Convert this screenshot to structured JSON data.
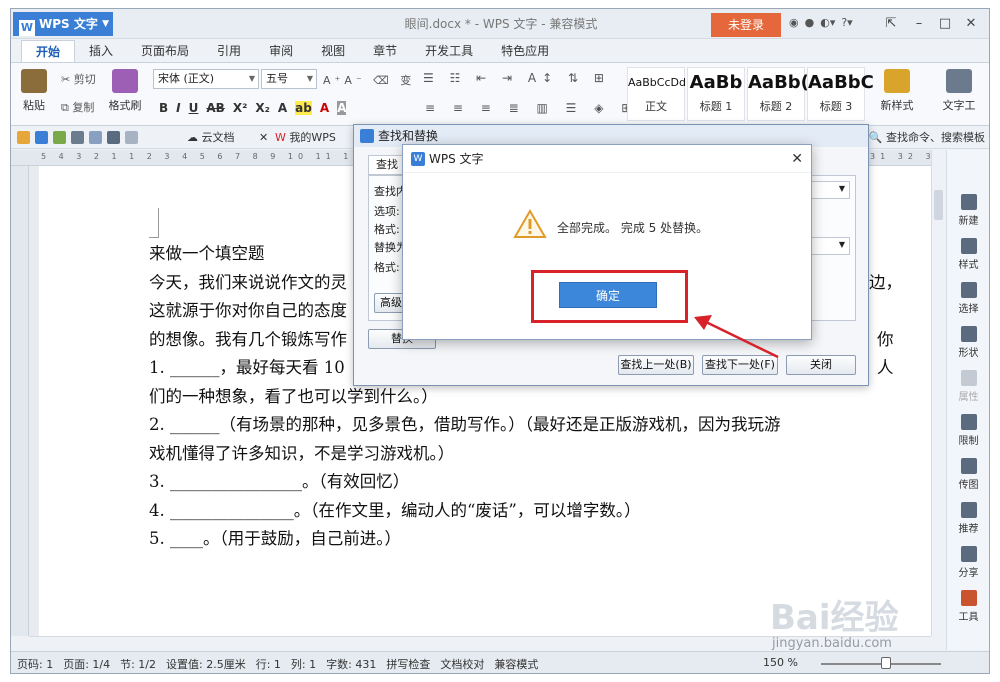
{
  "window": {
    "app_menu": "WPS 文字",
    "title": "眼间.docx * - WPS 文字 - 兼容模式",
    "login": "未登录"
  },
  "tabs": [
    "开始",
    "插入",
    "页面布局",
    "引用",
    "审阅",
    "视图",
    "章节",
    "开发工具",
    "特色应用"
  ],
  "ribbon": {
    "paste": "粘贴",
    "cut": "剪切",
    "copy": "复制",
    "format_painter": "格式刷",
    "font_name": "宋体 (正文)",
    "font_size": "五号",
    "styles": [
      {
        "sample": "AaBbCcDd",
        "label": "正文"
      },
      {
        "sample": "AaBb",
        "label": "标题 1"
      },
      {
        "sample": "AaBb(",
        "label": "标题 2"
      },
      {
        "sample": "AaBbC",
        "label": "标题 3"
      }
    ],
    "new_style": "新样式",
    "text_tool": "文字工"
  },
  "quickbar": {
    "cloud_doc": "云文档",
    "my_wps": "我的WPS",
    "search": "查找命令、搜索模板"
  },
  "ruler": "5 4 3 2 1 1 2 3 4 5 6 7 8 9 10 11 12 13 14 15 16 17 18 19 20 21 22 23 24 25 26 27 28 29 30 31 32 33 34 35 36 37 38 39 40 41",
  "document": {
    "lines": [
      "来做一个填空题",
      "今天，我们来说说作文的灵",
      "这就源于你对你自己的态度",
      "的想像。我有几个锻炼写作",
      "1. ______，最好每天看 10",
      "们的一种想象，看了也可以学到什么。）",
      "2. ______（有场景的那种，见多景色，借助写作。）（最好还是正版游戏机，因为我玩游",
      "戏机懂得了许多知识，不是学习游戏机。）",
      "3. ________________。（有效回忆）",
      "4. _______________。（在作文里，编动人的“废话”，可以增字数。）",
      "5. ____。（用于鼓励，自己前进。）"
    ],
    "right_fragments": [
      "边，",
      "你",
      "人"
    ]
  },
  "side_panel": [
    "新建",
    "样式",
    "选择",
    "形状",
    "属性",
    "限制",
    "传图",
    "推荐",
    "分享",
    "工具"
  ],
  "status": {
    "items": [
      "页码: 1",
      "页面: 1/4",
      "节: 1/2",
      "设置值: 2.5厘米",
      "行: 1",
      "列: 1",
      "字数: 431",
      "拼写检查",
      "文档校对",
      "兼容模式"
    ],
    "zoom": "150 %"
  },
  "find_replace": {
    "title": "查找和替换",
    "tab_find": "查找",
    "find_label": "查找内",
    "options_label": "选项:",
    "format_label1": "格式:",
    "replace_label": "替换为",
    "format_label2": "格式:",
    "advanced": "高级",
    "replace_btn": "替换",
    "find_prev": "查找上一处(B)",
    "find_next": "查找下一处(F)",
    "close": "关闭"
  },
  "message_box": {
    "title": "WPS 文字",
    "text": "全部完成。 完成 5 处替换。",
    "ok": "确定"
  },
  "watermark": {
    "big": "Bai经验",
    "small": "jingyan.baidu.com"
  },
  "colors": {
    "accent": "#3a7fd5",
    "login": "#e4683c",
    "annotation": "#d7222a"
  }
}
